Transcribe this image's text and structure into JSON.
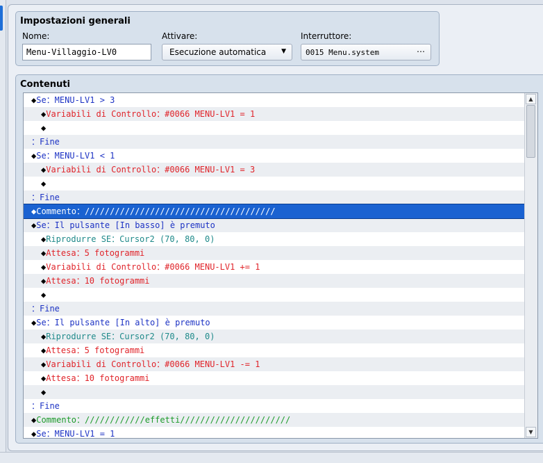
{
  "settings": {
    "title": "Impostazioni generali",
    "name_label": "Nome:",
    "name_value": "Menu-Villaggio-LV0",
    "trigger_label": "Attivare:",
    "trigger_value": "Esecuzione automatica",
    "switch_label": "Interruttore:",
    "switch_value": "0015 Menu.system",
    "switch_button": "⋯"
  },
  "contents": {
    "title": "Contenuti",
    "rows": [
      {
        "indent": 0,
        "bullet": "◆",
        "color": "blue",
        "text": "Se：MENU-LV1 > 3"
      },
      {
        "indent": 1,
        "bullet": "◆",
        "color": "red",
        "text": "Variabili di Controllo：#0066 MENU-LV1 = 1"
      },
      {
        "indent": 1,
        "bullet": "◆",
        "color": "blue",
        "text": ""
      },
      {
        "indent": 0,
        "bullet": "",
        "color": "blue",
        "text": "：Fine"
      },
      {
        "indent": 0,
        "bullet": "◆",
        "color": "blue",
        "text": "Se：MENU-LV1 < 1"
      },
      {
        "indent": 1,
        "bullet": "◆",
        "color": "red",
        "text": "Variabili di Controllo：#0066 MENU-LV1 = 3"
      },
      {
        "indent": 1,
        "bullet": "◆",
        "color": "blue",
        "text": ""
      },
      {
        "indent": 0,
        "bullet": "",
        "color": "blue",
        "text": "：Fine"
      },
      {
        "indent": 0,
        "bullet": "◆",
        "color": "white",
        "text": "Commento：//////////////////////////////////////",
        "selected": true
      },
      {
        "indent": 0,
        "bullet": "◆",
        "color": "blue",
        "text": "Se：Il pulsante [In basso] è premuto"
      },
      {
        "indent": 1,
        "bullet": "◆",
        "color": "teal",
        "text": "Riprodurre SE：Cursor2 (70, 80, 0)"
      },
      {
        "indent": 1,
        "bullet": "◆",
        "color": "red",
        "text": "Attesa：5 fotogrammi"
      },
      {
        "indent": 1,
        "bullet": "◆",
        "color": "red",
        "text": "Variabili di Controllo：#0066 MENU-LV1 += 1"
      },
      {
        "indent": 1,
        "bullet": "◆",
        "color": "red",
        "text": "Attesa：10 fotogrammi"
      },
      {
        "indent": 1,
        "bullet": "◆",
        "color": "blue",
        "text": ""
      },
      {
        "indent": 0,
        "bullet": "",
        "color": "blue",
        "text": "：Fine"
      },
      {
        "indent": 0,
        "bullet": "◆",
        "color": "blue",
        "text": "Se：Il pulsante [In alto] è premuto"
      },
      {
        "indent": 1,
        "bullet": "◆",
        "color": "teal",
        "text": "Riprodurre SE：Cursor2 (70, 80, 0)"
      },
      {
        "indent": 1,
        "bullet": "◆",
        "color": "red",
        "text": "Attesa：5 fotogrammi"
      },
      {
        "indent": 1,
        "bullet": "◆",
        "color": "red",
        "text": "Variabili di Controllo：#0066 MENU-LV1 -= 1"
      },
      {
        "indent": 1,
        "bullet": "◆",
        "color": "red",
        "text": "Attesa：10 fotogrammi"
      },
      {
        "indent": 1,
        "bullet": "◆",
        "color": "blue",
        "text": ""
      },
      {
        "indent": 0,
        "bullet": "",
        "color": "blue",
        "text": "：Fine"
      },
      {
        "indent": 0,
        "bullet": "◆",
        "color": "green",
        "text": "Commento：////////////effetti//////////////////////"
      },
      {
        "indent": 0,
        "bullet": "◆",
        "color": "blue",
        "text": "Se：MENU-LV1 = 1"
      }
    ]
  },
  "colors": {
    "selection": "#1a62d1",
    "blue": "#1d33c4",
    "red": "#e0242a",
    "teal": "#1f8a8a",
    "green": "#1c9a2a"
  },
  "icons": {
    "scroll_up": "triangle-up-icon",
    "scroll_down": "triangle-down-icon",
    "dropdown": "chevron-down-icon"
  }
}
